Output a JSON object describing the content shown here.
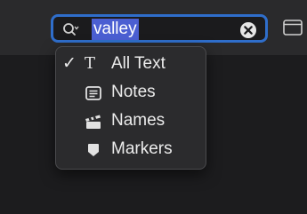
{
  "search": {
    "value": "valley"
  },
  "menu": {
    "items": [
      {
        "label": "All Text",
        "icon": "text-icon",
        "checked": true
      },
      {
        "label": "Notes",
        "icon": "notes-icon",
        "checked": false
      },
      {
        "label": "Names",
        "icon": "clapperboard-icon",
        "checked": false
      },
      {
        "label": "Markers",
        "icon": "marker-icon",
        "checked": false
      }
    ]
  },
  "glyphs": {
    "check": "✓",
    "text_icon": "T"
  },
  "colors": {
    "focus_ring": "#2f6ecb",
    "selection": "#4b5fd2",
    "menu_background": "#2b2b2d",
    "window_background": "#1c1c1e"
  }
}
